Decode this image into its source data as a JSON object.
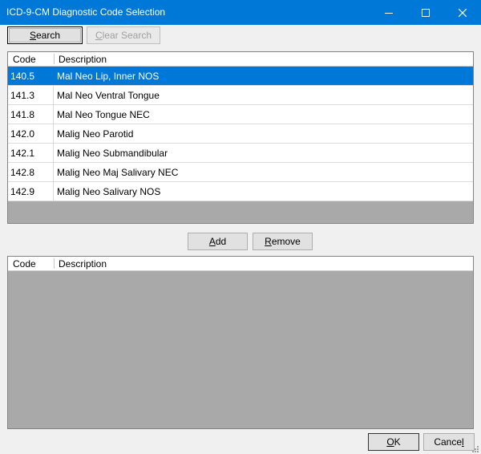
{
  "window": {
    "title": "ICD-9-CM Diagnostic Code Selection",
    "titlebar_color": "#0078d7",
    "selection_color": "#0078d7"
  },
  "toolbar": {
    "search_label": "Search",
    "clear_search_label": "Clear Search"
  },
  "results": {
    "headers": {
      "code": "Code",
      "description": "Description"
    },
    "rows": [
      {
        "code": "140.5",
        "description": "Mal Neo Lip, Inner NOS",
        "selected": true
      },
      {
        "code": "141.3",
        "description": "Mal Neo Ventral Tongue"
      },
      {
        "code": "141.8",
        "description": "Mal Neo Tongue NEC"
      },
      {
        "code": "142.0",
        "description": "Malig Neo Parotid"
      },
      {
        "code": "142.1",
        "description": "Malig Neo Submandibular"
      },
      {
        "code": "142.8",
        "description": "Malig Neo Maj Salivary NEC"
      },
      {
        "code": "142.9",
        "description": "Malig Neo Salivary NOS"
      }
    ]
  },
  "actions": {
    "add_label": "Add",
    "remove_label": "Remove"
  },
  "selected": {
    "headers": {
      "code": "Code",
      "description": "Description"
    },
    "rows": []
  },
  "footer": {
    "ok_label": "OK",
    "cancel_label": "Cancel"
  }
}
